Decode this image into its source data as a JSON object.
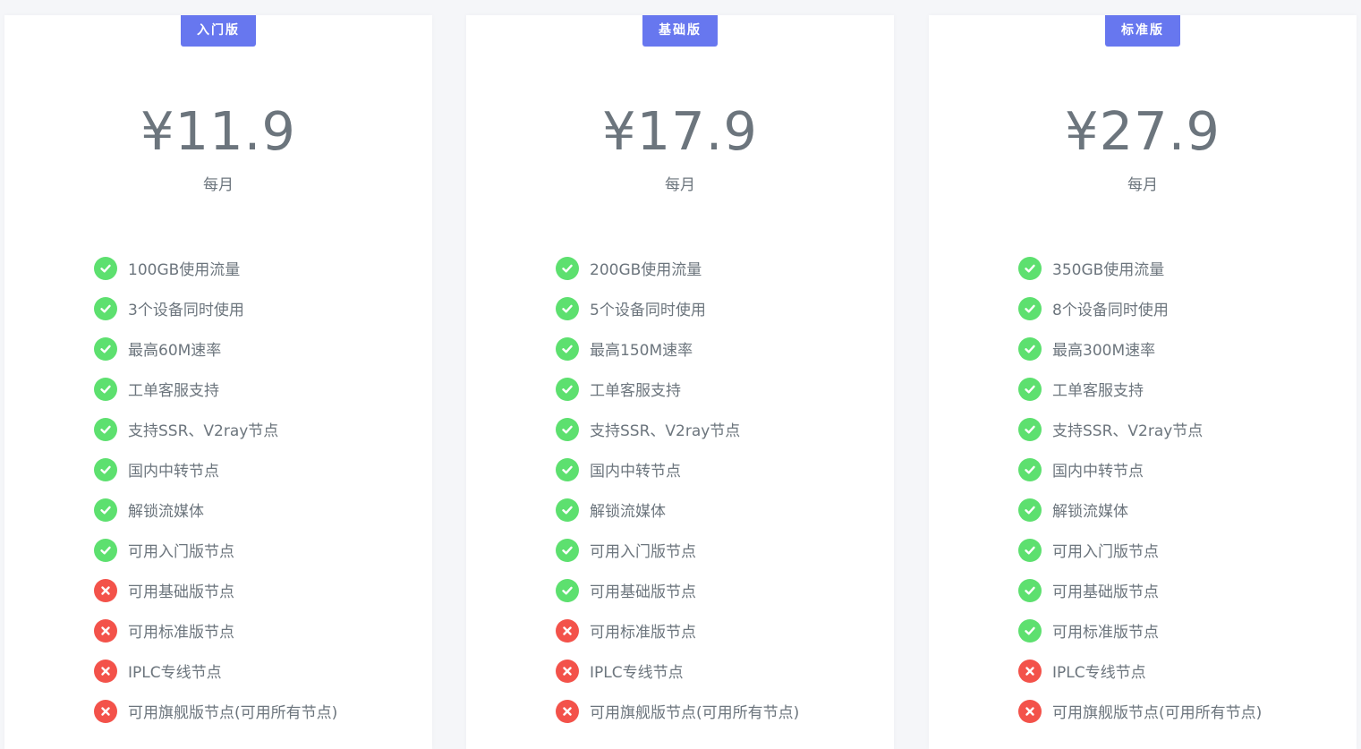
{
  "colors": {
    "page_background": "#f5f6f9",
    "badge": "#6777ef",
    "included": "#5de06f",
    "excluded": "#f3524a",
    "text": "#6c757d"
  },
  "plans": [
    {
      "name": "入门版",
      "price": "¥11.9",
      "period": "每月",
      "features": [
        {
          "text": "100GB使用流量",
          "included": true
        },
        {
          "text": "3个设备同时使用",
          "included": true
        },
        {
          "text": "最高60M速率",
          "included": true
        },
        {
          "text": "工单客服支持",
          "included": true
        },
        {
          "text": "支持SSR、V2ray节点",
          "included": true
        },
        {
          "text": "国内中转节点",
          "included": true
        },
        {
          "text": "解锁流媒体",
          "included": true
        },
        {
          "text": "可用入门版节点",
          "included": true
        },
        {
          "text": "可用基础版节点",
          "included": false
        },
        {
          "text": "可用标准版节点",
          "included": false
        },
        {
          "text": "IPLC专线节点",
          "included": false
        },
        {
          "text": "可用旗舰版节点(可用所有节点)",
          "included": false
        }
      ]
    },
    {
      "name": "基础版",
      "price": "¥17.9",
      "period": "每月",
      "features": [
        {
          "text": "200GB使用流量",
          "included": true
        },
        {
          "text": "5个设备同时使用",
          "included": true
        },
        {
          "text": "最高150M速率",
          "included": true
        },
        {
          "text": "工单客服支持",
          "included": true
        },
        {
          "text": "支持SSR、V2ray节点",
          "included": true
        },
        {
          "text": "国内中转节点",
          "included": true
        },
        {
          "text": "解锁流媒体",
          "included": true
        },
        {
          "text": "可用入门版节点",
          "included": true
        },
        {
          "text": "可用基础版节点",
          "included": true
        },
        {
          "text": "可用标准版节点",
          "included": false
        },
        {
          "text": "IPLC专线节点",
          "included": false
        },
        {
          "text": "可用旗舰版节点(可用所有节点)",
          "included": false
        }
      ]
    },
    {
      "name": "标准版",
      "price": "¥27.9",
      "period": "每月",
      "features": [
        {
          "text": "350GB使用流量",
          "included": true
        },
        {
          "text": "8个设备同时使用",
          "included": true
        },
        {
          "text": "最高300M速率",
          "included": true
        },
        {
          "text": "工单客服支持",
          "included": true
        },
        {
          "text": "支持SSR、V2ray节点",
          "included": true
        },
        {
          "text": "国内中转节点",
          "included": true
        },
        {
          "text": "解锁流媒体",
          "included": true
        },
        {
          "text": "可用入门版节点",
          "included": true
        },
        {
          "text": "可用基础版节点",
          "included": true
        },
        {
          "text": "可用标准版节点",
          "included": true
        },
        {
          "text": "IPLC专线节点",
          "included": false
        },
        {
          "text": "可用旗舰版节点(可用所有节点)",
          "included": false
        }
      ]
    }
  ]
}
